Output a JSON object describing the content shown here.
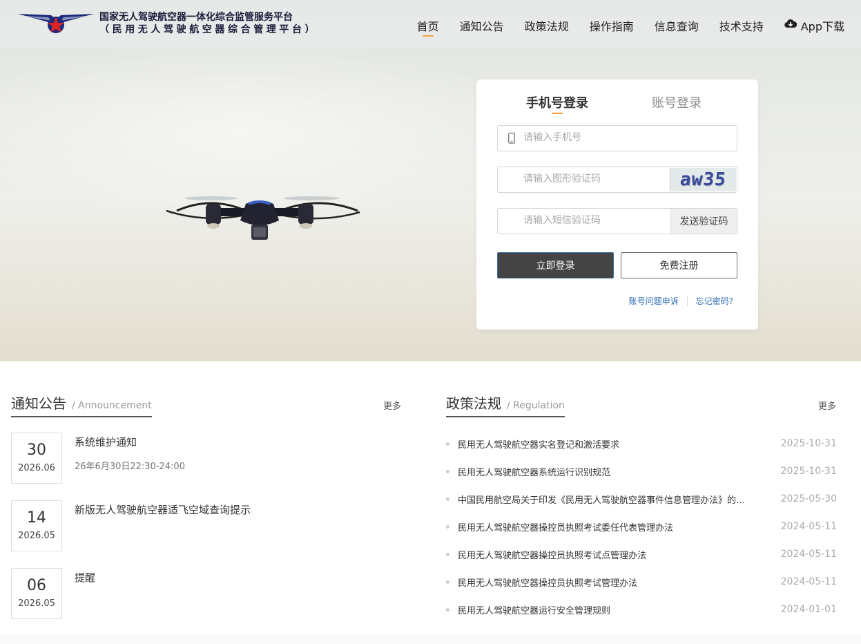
{
  "header": {
    "brand_line1": "国家无人驾驶航空器一体化综合监管服务平台",
    "brand_line2": "（民用无人驾驶航空器综合管理平台）",
    "nav": [
      "首页",
      "通知公告",
      "政策法规",
      "操作指南",
      "信息查询",
      "技术支持"
    ],
    "app_download": "App下载"
  },
  "login": {
    "tab_phone": "手机号登录",
    "tab_account": "账号登录",
    "phone_placeholder": "请输入手机号",
    "captcha_placeholder": "请输入图形验证码",
    "captcha_text": "aw35",
    "sms_placeholder": "请输入短信验证码",
    "send_code": "发送验证码",
    "login_button": "立即登录",
    "register_button": "免费注册",
    "appeal_link": "账号问题申诉",
    "forgot_link": "忘记密码?"
  },
  "notices": {
    "title": "通知公告",
    "title_en": "/ Announcement",
    "more": "更多",
    "items": [
      {
        "day": "30",
        "ym": "2026.06",
        "title": "系统维护通知",
        "sub": "26年6月30日22:30-24:00"
      },
      {
        "day": "14",
        "ym": "2026.05",
        "title": "新版无人驾驶航空器适飞空域查询提示",
        "sub": ""
      },
      {
        "day": "06",
        "ym": "2026.05",
        "title": "提醒",
        "sub": ""
      }
    ]
  },
  "policies": {
    "title": "政策法规",
    "title_en": "/ Regulation",
    "more": "更多",
    "items": [
      {
        "title": "民用无人驾驶航空器实名登记和激活要求",
        "date": "2025-10-31"
      },
      {
        "title": "民用无人驾驶航空器系统运行识别规范",
        "date": "2025-10-31"
      },
      {
        "title": "中国民用航空局关于印发《民用无人驾驶航空器事件信息管理办法》的通知",
        "date": "2025-05-30"
      },
      {
        "title": "民用无人驾驶航空器操控员执照考试委任代表管理办法",
        "date": "2024-05-11"
      },
      {
        "title": "民用无人驾驶航空器操控员执照考试点管理办法",
        "date": "2024-05-11"
      },
      {
        "title": "民用无人驾驶航空器操控员执照考试管理办法",
        "date": "2024-05-11"
      },
      {
        "title": "民用无人驾驶航空器运行安全管理规则",
        "date": "2024-01-01"
      }
    ]
  },
  "colors": {
    "accent": "#f2a33a",
    "link": "#2a6bb5",
    "dark_button": "#444444"
  }
}
